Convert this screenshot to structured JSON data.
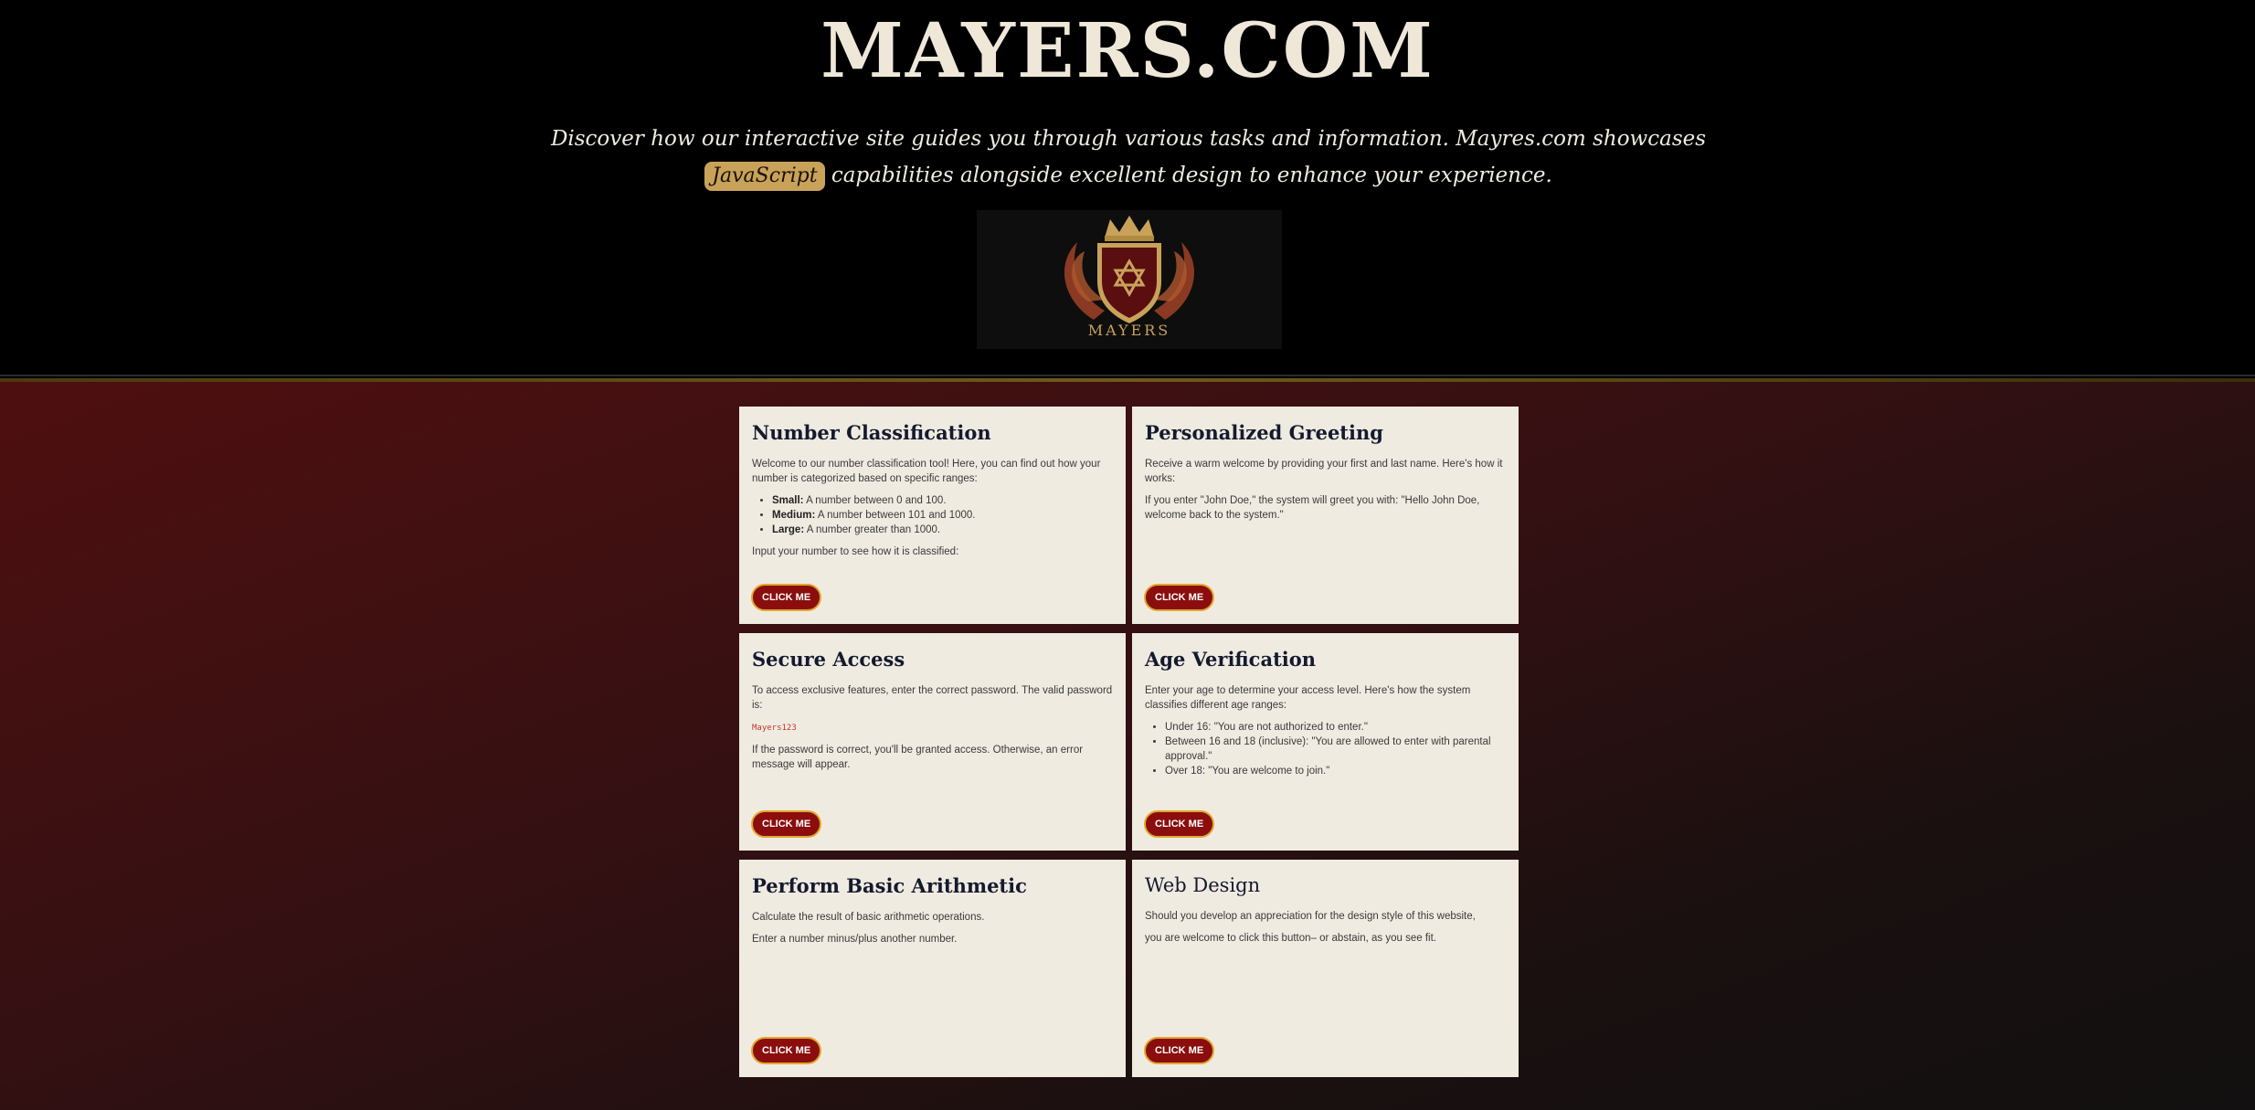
{
  "header": {
    "title": "MAYERS.COM",
    "tagline_before": "Discover how our interactive site guides you through various tasks and information. Mayres.com showcases",
    "tagline_pill": "JavaScript",
    "tagline_after": "capabilities alongside excellent design to enhance your experience.",
    "logo_text": "MAYERS"
  },
  "cards": {
    "number": {
      "title": "Number Classification",
      "intro": "Welcome to our number classification tool! Here, you can find out how your number is categorized based on specific ranges:",
      "items": [
        {
          "label": "Small:",
          "text": "A number between 0 and 100."
        },
        {
          "label": "Medium:",
          "text": "A number between 101 and 1000."
        },
        {
          "label": "Large:",
          "text": "A number greater than 1000."
        }
      ],
      "outro": "Input your number to see how it is classified:",
      "button": "CLICK ME"
    },
    "greeting": {
      "title": "Personalized Greeting",
      "p1": "Receive a warm welcome by providing your first and last name. Here's how it works:",
      "p2": "If you enter \"John Doe,\" the system will greet you with: \"Hello John Doe, welcome back to the system.\"",
      "button": "CLICK ME"
    },
    "secure": {
      "title": "Secure Access",
      "p1": "To access exclusive features, enter the correct password. The valid password is:",
      "code": "Mayers123",
      "p2": "If the password is correct, you'll be granted access. Otherwise, an error message will appear.",
      "button": "CLICK ME"
    },
    "age": {
      "title": "Age Verification",
      "p1": "Enter your age to determine your access level. Here's how the system classifies different age ranges:",
      "items": [
        "Under 16: \"You are not authorized to enter.\"",
        "Between 16 and 18 (inclusive): \"You are allowed to enter with parental approval.\"",
        "Over 18: \"You are welcome to join.\""
      ],
      "button": "CLICK ME"
    },
    "arithmetic": {
      "title": "Perform Basic Arithmetic",
      "p1": "Calculate the result of basic arithmetic operations.",
      "p2": "Enter a number minus/plus another number.",
      "button": "CLICK ME"
    },
    "design": {
      "title": "Web Design",
      "p1": "Should you develop an appreciation for the design style of this website,",
      "p2": "you are welcome to click this button– or abstain, as you see fit.",
      "button": "CLICK ME"
    }
  },
  "colors": {
    "button_bg": "#8b0d0d",
    "button_border": "#e0a82e",
    "card_bg": "#f0ebe1",
    "accent_gold": "#c9a25a"
  }
}
